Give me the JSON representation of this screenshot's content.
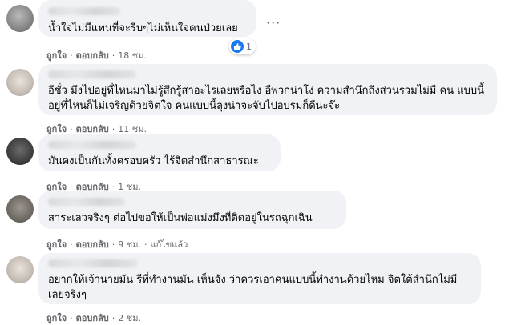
{
  "meta": {
    "like": "ถูกใจ",
    "reply": "ตอบกลับ",
    "separator": "·"
  },
  "comments": [
    {
      "text": "น้ำใจไม่มีแทนที่จะรีบๆไม่เห็นใจคนป่วยเลย",
      "time": "18 ชม.",
      "reactions": {
        "icon": "like-icon",
        "count": "1"
      }
    },
    {
      "text": "อีชั่ว มึงไปอยู่ที่ไหนมาไม่รู้สึกรู้สาอะไรเลยหรือไง อีพวกน่าโง่ ความสำนึกถึงส่วนรวมไม่มี คน แบบนี้อยู่ที่ไหนก็ไม่เจริญด้วยจิตใจ คนแบบนี้ลุงน่าจะจับไปอบรมก็ดีนะจ๊ะ",
      "time": "11 ชม."
    },
    {
      "text": "มันคงเป็นกันทั้งครอบครัว ไร้จิตสำนึกสาธารณะ",
      "time": "1 ชม."
    },
    {
      "text": "สาระเลวจริงๆ ต่อไปขอให้เป็นพ่อแม่งมึงที่ติดอยู่ในรถฉุกเฉิน",
      "time": "9 ชม.",
      "edited": "แก้ไขแล้ว"
    },
    {
      "text": "อยากให้เจ้านายมัน รีที่ทำงานมัน เห็นจัง ว่าควรเอาคนแบบนี้ทำงานด้วยไหม จิตใต้สำนึกไม่มี เลยจริงๆ",
      "time": "2 ชม."
    }
  ]
}
